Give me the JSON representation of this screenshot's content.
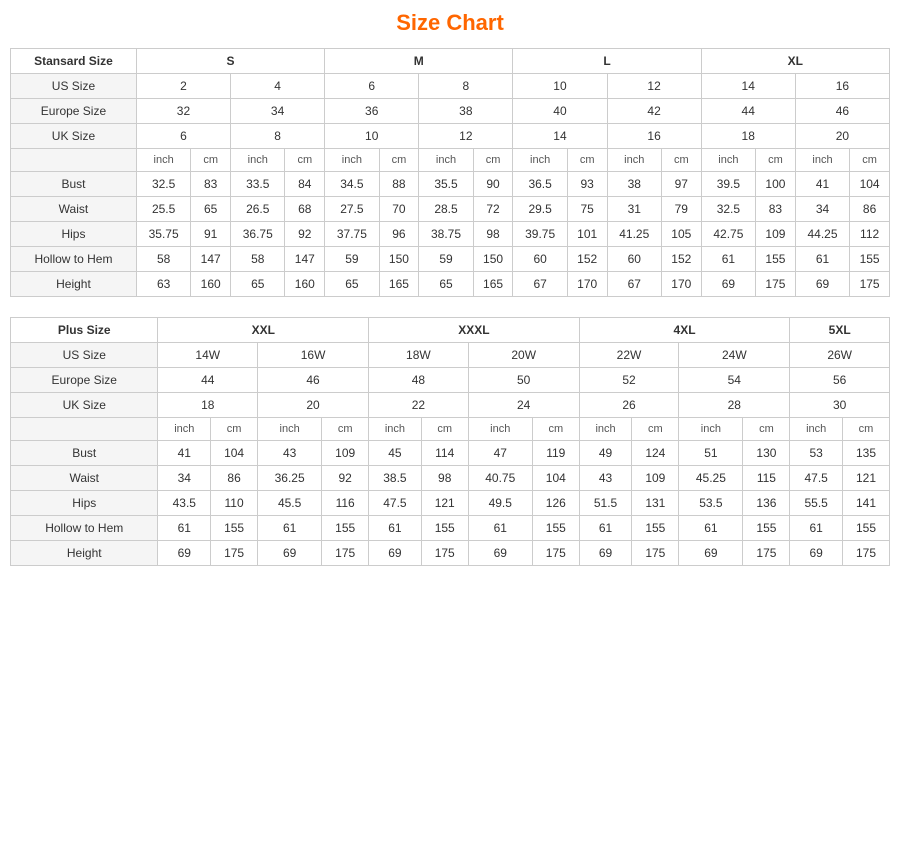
{
  "title": "Size Chart",
  "standard": {
    "label": "Stansard Size",
    "groups": [
      "S",
      "M",
      "L",
      "XL"
    ],
    "us_sizes": [
      "2",
      "4",
      "6",
      "8",
      "10",
      "12",
      "14",
      "16"
    ],
    "europe_sizes": [
      "32",
      "34",
      "36",
      "38",
      "40",
      "42",
      "44",
      "46"
    ],
    "uk_sizes": [
      "6",
      "8",
      "10",
      "12",
      "14",
      "16",
      "18",
      "20"
    ],
    "measurements": {
      "bust": [
        "32.5",
        "83",
        "33.5",
        "84",
        "34.5",
        "88",
        "35.5",
        "90",
        "36.5",
        "93",
        "38",
        "97",
        "39.5",
        "100",
        "41",
        "104"
      ],
      "waist": [
        "25.5",
        "65",
        "26.5",
        "68",
        "27.5",
        "70",
        "28.5",
        "72",
        "29.5",
        "75",
        "31",
        "79",
        "32.5",
        "83",
        "34",
        "86"
      ],
      "hips": [
        "35.75",
        "91",
        "36.75",
        "92",
        "37.75",
        "96",
        "38.75",
        "98",
        "39.75",
        "101",
        "41.25",
        "105",
        "42.75",
        "109",
        "44.25",
        "112"
      ],
      "hollow": [
        "58",
        "147",
        "58",
        "147",
        "59",
        "150",
        "59",
        "150",
        "60",
        "152",
        "60",
        "152",
        "61",
        "155",
        "61",
        "155"
      ],
      "height": [
        "63",
        "160",
        "65",
        "160",
        "65",
        "165",
        "65",
        "165",
        "67",
        "170",
        "67",
        "170",
        "69",
        "175",
        "69",
        "175"
      ]
    }
  },
  "plus": {
    "label": "Plus Size",
    "groups": [
      "XXL",
      "XXXL",
      "4XL",
      "5XL"
    ],
    "us_sizes": [
      "14W",
      "16W",
      "18W",
      "20W",
      "22W",
      "24W",
      "26W"
    ],
    "europe_sizes": [
      "44",
      "46",
      "48",
      "50",
      "52",
      "54",
      "56"
    ],
    "uk_sizes": [
      "18",
      "20",
      "22",
      "24",
      "26",
      "28",
      "30"
    ],
    "measurements": {
      "bust": [
        "41",
        "104",
        "43",
        "109",
        "45",
        "114",
        "47",
        "119",
        "49",
        "124",
        "51",
        "130",
        "53",
        "135"
      ],
      "waist": [
        "34",
        "86",
        "36.25",
        "92",
        "38.5",
        "98",
        "40.75",
        "104",
        "43",
        "109",
        "45.25",
        "115",
        "47.5",
        "121"
      ],
      "hips": [
        "43.5",
        "110",
        "45.5",
        "116",
        "47.5",
        "121",
        "49.5",
        "126",
        "51.5",
        "131",
        "53.5",
        "136",
        "55.5",
        "141"
      ],
      "hollow": [
        "61",
        "155",
        "61",
        "155",
        "61",
        "155",
        "61",
        "155",
        "61",
        "155",
        "61",
        "155",
        "61",
        "155"
      ],
      "height": [
        "69",
        "175",
        "69",
        "175",
        "69",
        "175",
        "69",
        "175",
        "69",
        "175",
        "69",
        "175",
        "69",
        "175"
      ]
    }
  }
}
